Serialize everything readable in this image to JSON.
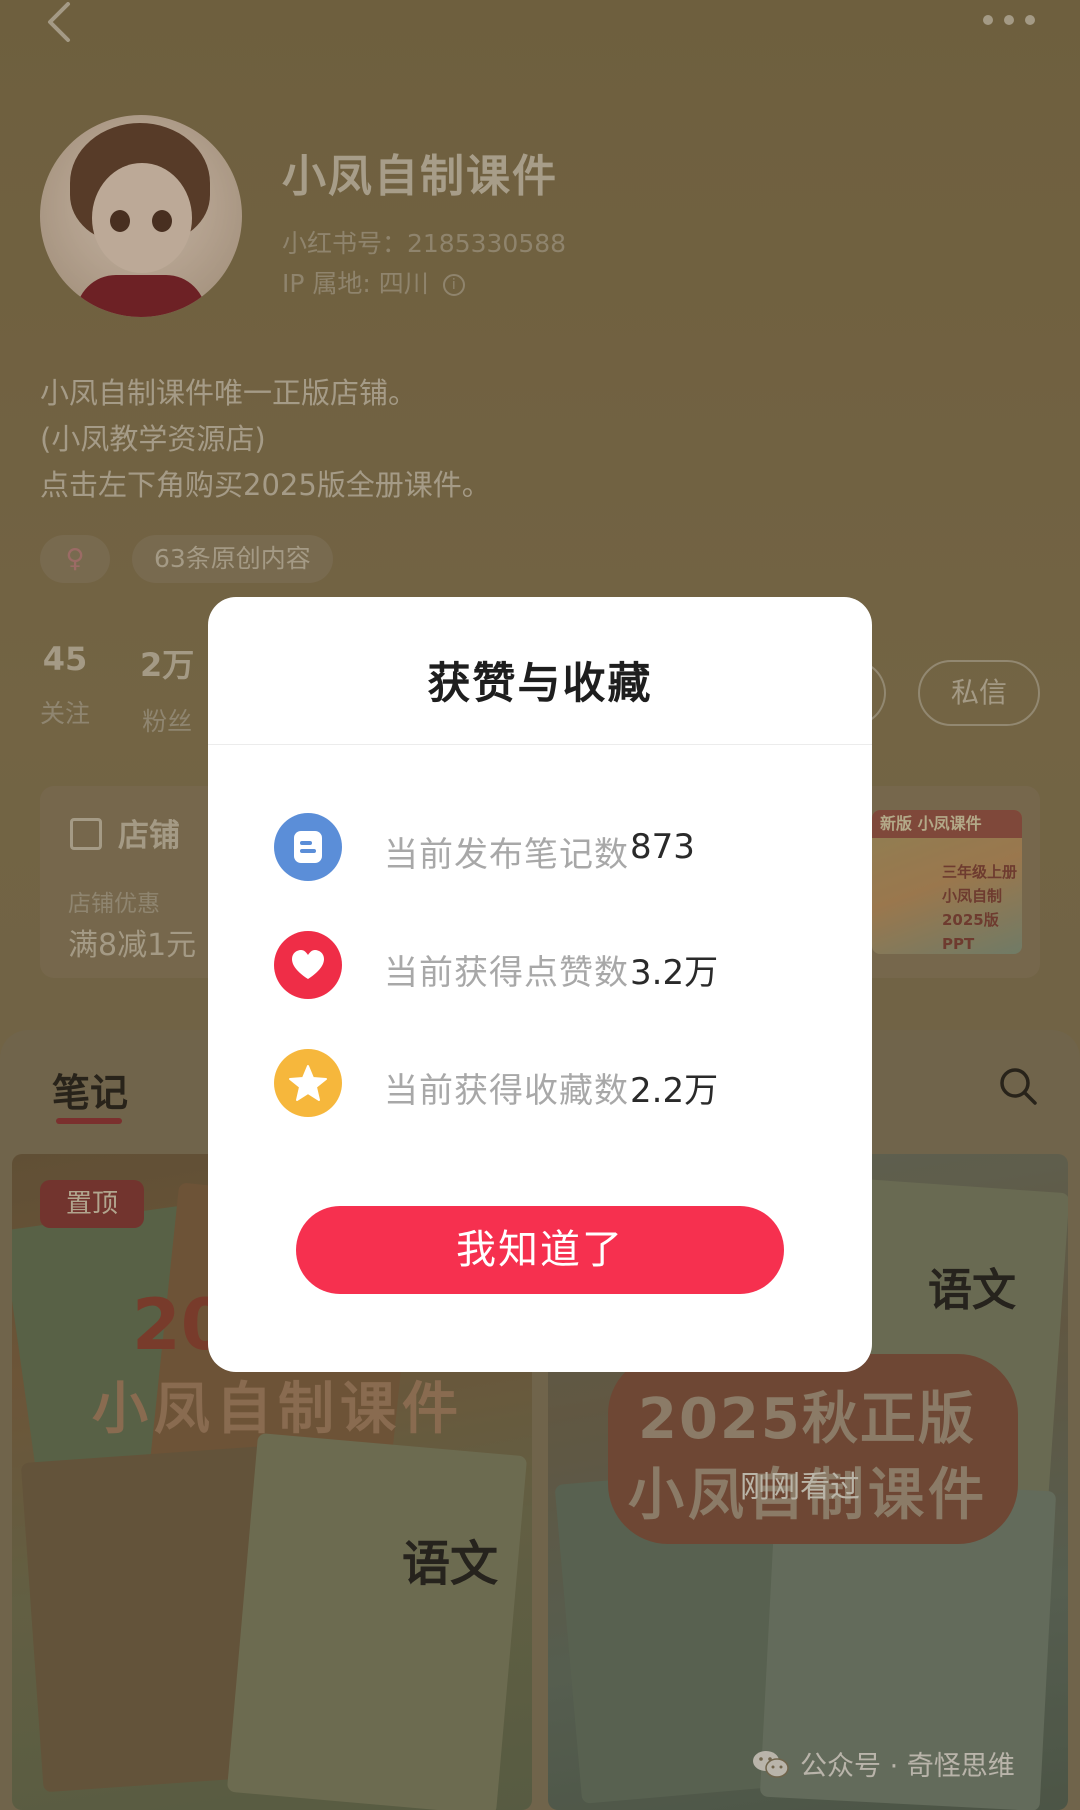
{
  "profile": {
    "name": "小凤自制课件",
    "id_line": "小红书号：2185330588",
    "ip_line": "IP 属地: 四川",
    "bio": [
      "小凤自制课件唯一正版店铺。",
      "(小凤教学资源店)",
      "点击左下角购买2025版全册课件。"
    ],
    "gender_symbol": "♀",
    "original_tag": "63条原创内容"
  },
  "stats": {
    "follow_count": "45",
    "follow_label": "关注",
    "fans_count": "2万",
    "fans_label": "粉丝",
    "message_button": "私信"
  },
  "shop": {
    "title": "店铺",
    "discount_label": "店铺优惠",
    "discount_value": "满8减1元",
    "thumb_top": "新版 小凤课件",
    "thumb_lines": "三年级上册\n小凤自制\n2025版 PPT"
  },
  "tabs": {
    "notes_label": "笔记"
  },
  "notes": {
    "pin_badge": "置顶",
    "cover1_top": "20",
    "cover1_main": "小凤自制课件",
    "cover1_yuwen": "语文",
    "cover2_line1": "2025秋正版",
    "cover2_line2": "小凤自制课件",
    "cover2_yuwen": "语文",
    "recent_badge": "刚刚看过"
  },
  "watermark": "公众号 · 奇怪思维",
  "modal": {
    "title": "获赞与收藏",
    "rows": [
      {
        "label": "当前发布笔记数",
        "value": "873",
        "icon": "notes-icon"
      },
      {
        "label": "当前获得点赞数",
        "value": "3.2万",
        "icon": "heart-icon"
      },
      {
        "label": "当前获得收藏数",
        "value": "2.2万",
        "icon": "star-icon"
      }
    ],
    "confirm_button": "我知道了"
  },
  "colors": {
    "accent": "#f6304f",
    "notes_icon": "#5b8ed8",
    "likes_icon": "#ef2d47",
    "collects_icon": "#f6b73c"
  }
}
